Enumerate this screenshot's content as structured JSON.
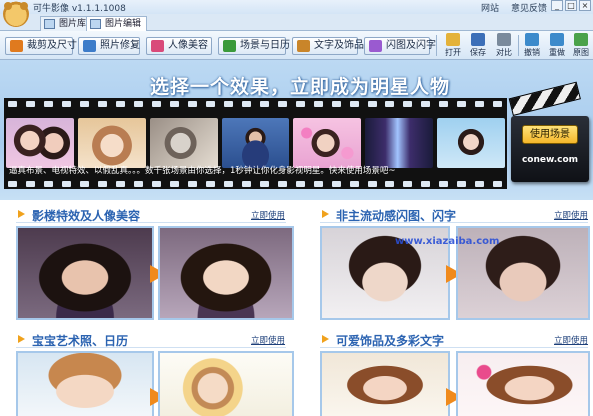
{
  "app": {
    "title": "可牛影像 v1.1.1.1008",
    "links": [
      "网站",
      "意见反馈"
    ]
  },
  "window": {
    "controls": [
      "_",
      "□",
      "×"
    ]
  },
  "tabs": [
    {
      "label": "图片库",
      "icon": "image-library-icon"
    },
    {
      "label": "图片编辑",
      "icon": "image-edit-icon"
    }
  ],
  "toolbar": {
    "buttons": [
      {
        "label": "裁剪及尺寸",
        "icon": "crop-icon",
        "color": "#e07a1e"
      },
      {
        "label": "照片修复",
        "icon": "photo-repair-icon",
        "color": "#3d7cc9"
      },
      {
        "label": "人像美容",
        "icon": "portrait-beauty-icon",
        "color": "#d94a7a"
      },
      {
        "label": "场景与日历",
        "icon": "scene-calendar-icon",
        "color": "#3b9a3b"
      },
      {
        "label": "文字及饰品",
        "icon": "text-decor-icon",
        "color": "#c9852a"
      },
      {
        "label": "闪图及闪字",
        "icon": "flash-icon",
        "color": "#9a5ad0"
      }
    ],
    "actions": [
      {
        "label": "打开",
        "icon": "open-folder-icon",
        "color": "#e4b23a"
      },
      {
        "label": "保存",
        "icon": "save-icon",
        "color": "#3c6fb8"
      },
      {
        "label": "对比",
        "icon": "compare-icon",
        "color": "#7a8a9c"
      },
      {
        "label": "撤销",
        "icon": "undo-icon",
        "color": "#3c8acb"
      },
      {
        "label": "重做",
        "icon": "redo-icon",
        "color": "#3c8acb"
      },
      {
        "label": "原图",
        "icon": "original-icon",
        "color": "#4aa24a"
      }
    ]
  },
  "banner": {
    "headline": "选择一个效果，立即成为明星人物",
    "description": "逼真布景、电视特效、以假乱真。。。数千张场景由你选择，1秒钟让你化身影视明星。快来使用场景吧~",
    "cta_button": "使用场景",
    "site": "conew.com"
  },
  "sections": [
    {
      "title": "影楼特效及人像美容",
      "link": "立即使用"
    },
    {
      "title": "非主流动感闪图、闪字",
      "link": "立即使用"
    },
    {
      "title": "宝宝艺术照、日历",
      "link": "立即使用"
    },
    {
      "title": "可爱饰品及多彩文字",
      "link": "立即使用"
    }
  ],
  "watermark": "www.xiazaiba.com"
}
